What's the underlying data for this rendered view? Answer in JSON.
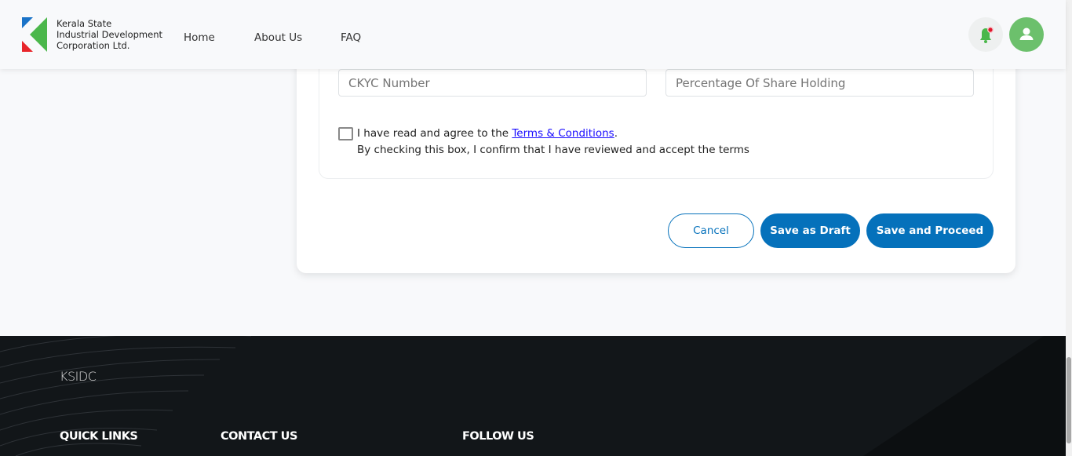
{
  "header": {
    "brand_lines": [
      "Kerala State",
      "Industrial Development",
      "Corporation Ltd."
    ],
    "nav": [
      "Home",
      "About Us",
      "FAQ"
    ]
  },
  "form": {
    "ckyc_placeholder": "CKYC Number",
    "share_placeholder": "Percentage Of Share Holding",
    "terms_prefix": "I have read and agree to the ",
    "terms_link": "Terms & Conditions",
    "terms_suffix": ".",
    "terms_note": "By checking this box, I confirm that I have reviewed and accept the terms"
  },
  "actions": {
    "cancel": "Cancel",
    "draft": "Save as Draft",
    "proceed": "Save and Proceed"
  },
  "footer": {
    "brand": "KSIDC",
    "quick_links": "QUICK LINKS",
    "contact": "CONTACT US",
    "follow": "FOLLOW US"
  },
  "colors": {
    "primary": "#0571bb",
    "green": "#4bb74b",
    "footer_bg": "#121619"
  }
}
